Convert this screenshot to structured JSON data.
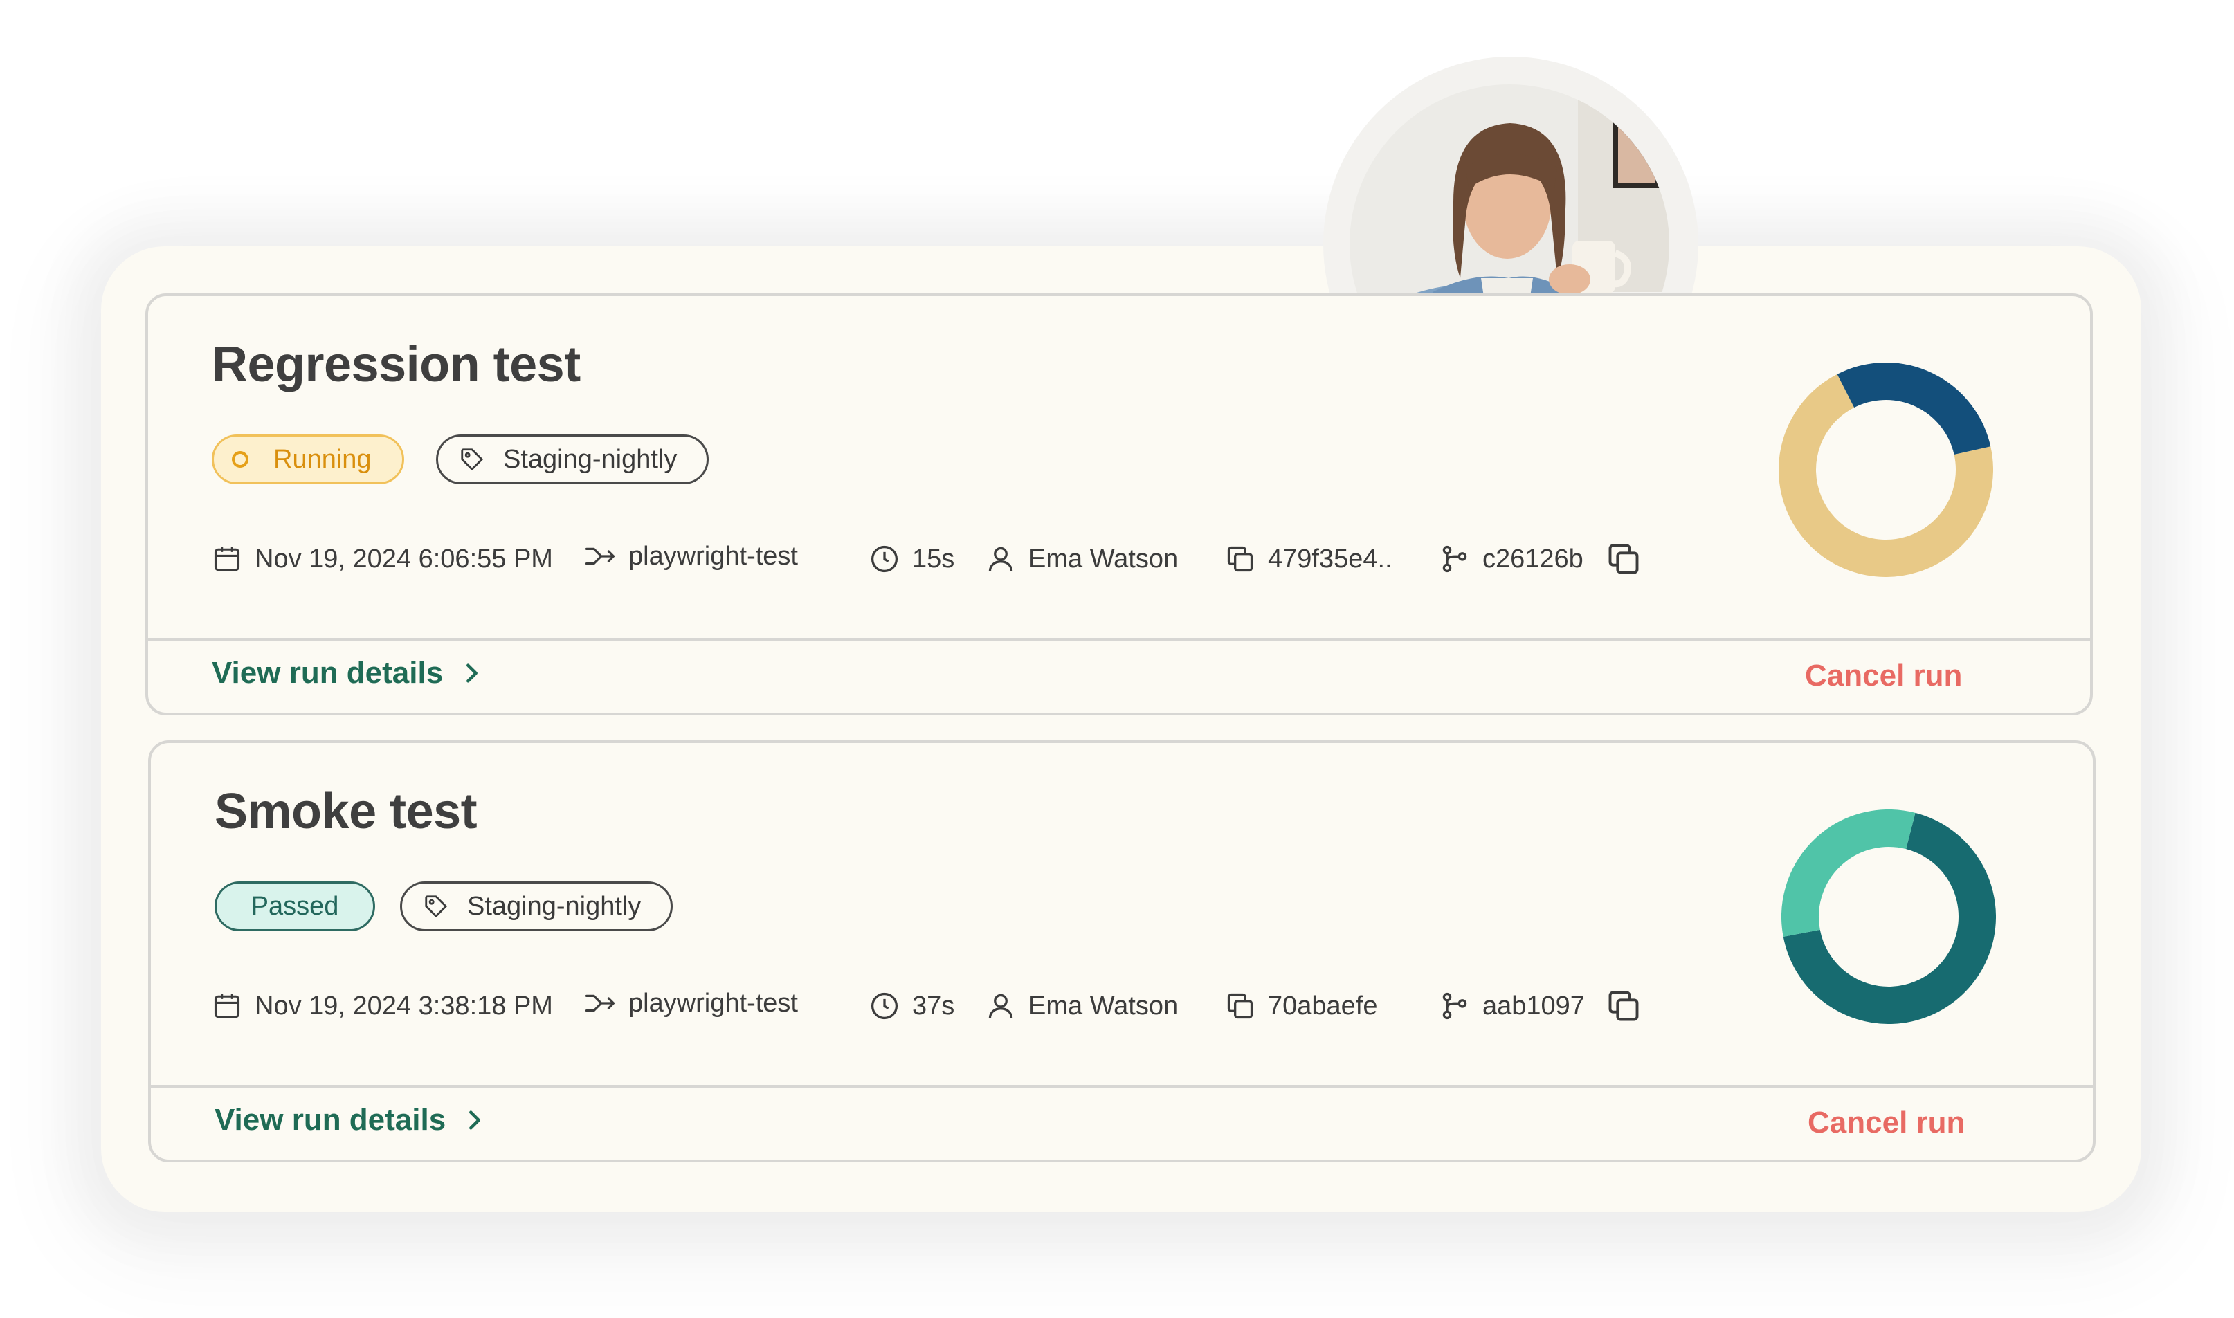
{
  "runs": [
    {
      "title": "Regression test",
      "status": "Running",
      "tag": "Staging-nightly",
      "date": "Nov 19, 2024 6:06:55 PM",
      "project": "playwright-test",
      "duration": "15s",
      "user": "Ema Watson",
      "commit": "479f35e4..",
      "branch": "c26126b",
      "view_label": "View run details",
      "cancel_label": "Cancel run",
      "chart": {
        "segments": [
          {
            "fraction": 0.71,
            "color": "#e8c987"
          },
          {
            "fraction": 0.29,
            "color": "#134f7b"
          }
        ]
      }
    },
    {
      "title": "Smoke test",
      "status": "Passed",
      "tag": "Staging-nightly",
      "date": "Nov 19, 2024 3:38:18 PM",
      "project": "playwright-test",
      "duration": "37s",
      "user": "Ema Watson",
      "commit": "70abaefe",
      "branch": "aab1097",
      "view_label": "View run details",
      "cancel_label": "Cancel run",
      "chart": {
        "segments": [
          {
            "fraction": 0.68,
            "color": "#176b70"
          },
          {
            "fraction": 0.32,
            "color": "#50c4a8"
          }
        ]
      }
    }
  ],
  "colors": {
    "panel_bg": "#fcfaf3",
    "running": "#d98f0d",
    "passed": "#23675c",
    "link": "#1f6b55",
    "cancel": "#e86a63"
  },
  "icons": [
    "calendar-icon",
    "arrow-merge-icon",
    "clock-icon",
    "user-icon",
    "copy-icon",
    "git-branch-icon",
    "tag-icon",
    "chevron-right-icon"
  ]
}
